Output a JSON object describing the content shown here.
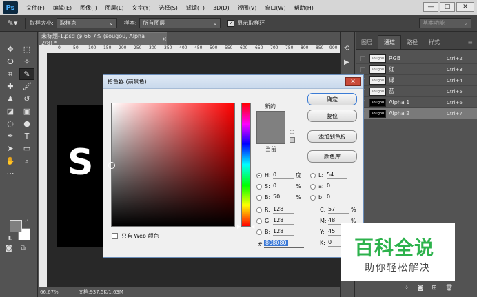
{
  "app": {
    "logo": "Ps"
  },
  "menu": [
    "文件(F)",
    "编辑(E)",
    "图像(I)",
    "图层(L)",
    "文字(Y)",
    "选择(S)",
    "滤镜(T)",
    "3D(D)",
    "视图(V)",
    "窗口(W)",
    "帮助(H)"
  ],
  "window_controls": {
    "minimize": "—",
    "maximize": "□",
    "close": "✕"
  },
  "options_bar": {
    "sample_size_label": "取样大小:",
    "sample_size_value": "取样点",
    "sample_label": "样本:",
    "sample_value": "所有图层",
    "show_ring_label": "显示取样环",
    "show_ring_checked": "✓",
    "workspace": "基本功能"
  },
  "document": {
    "tab_title": "未标题-1.psd @ 66.7% (sougou, Alpha 2/8) *",
    "tab_close": "×",
    "ruler_ticks": [
      "0",
      "50",
      "100",
      "150",
      "200",
      "250",
      "300",
      "350",
      "400",
      "450",
      "500",
      "550",
      "600",
      "650",
      "700",
      "750",
      "800",
      "850",
      "900"
    ],
    "canvas_text": "S",
    "zoom": "66.67%",
    "doc_info": "文档:937.5K/1.63M"
  },
  "dock_icons": [
    "history-icon",
    "play-icon"
  ],
  "panel": {
    "tabs": [
      "图层",
      "通道",
      "路径",
      "样式"
    ],
    "active_tab": "通道",
    "channels": [
      {
        "name": "RGB",
        "shortcut": "Ctrl+2",
        "thumb": "sougou",
        "dark": false
      },
      {
        "name": "红",
        "shortcut": "Ctrl+3",
        "thumb": "sougou",
        "dark": false
      },
      {
        "name": "绿",
        "shortcut": "Ctrl+4",
        "thumb": "sougou",
        "dark": false
      },
      {
        "name": "蓝",
        "shortcut": "Ctrl+5",
        "thumb": "sougou",
        "dark": false
      },
      {
        "name": "Alpha 1",
        "shortcut": "Ctrl+6",
        "thumb": "sougou",
        "dark": true
      },
      {
        "name": "Alpha 2",
        "shortcut": "Ctrl+7",
        "thumb": "sougou",
        "dark": true
      }
    ]
  },
  "color_picker": {
    "title": "拾色器 (前景色)",
    "new_label": "新的",
    "current_label": "当前",
    "web_only_label": "只有 Web 颜色",
    "buttons": {
      "ok": "确定",
      "reset": "复位",
      "add_swatch": "添加到色板",
      "libraries": "颜色库"
    },
    "current_color": "#808080",
    "fields_left": [
      {
        "label": "H:",
        "value": "0",
        "unit": "度"
      },
      {
        "label": "S:",
        "value": "0",
        "unit": "%"
      },
      {
        "label": "B:",
        "value": "50",
        "unit": "%"
      },
      {
        "label": "R:",
        "value": "128",
        "unit": ""
      },
      {
        "label": "G:",
        "value": "128",
        "unit": ""
      },
      {
        "label": "B:",
        "value": "128",
        "unit": ""
      }
    ],
    "fields_lab": [
      {
        "label": "L:",
        "value": "54"
      },
      {
        "label": "a:",
        "value": "0"
      },
      {
        "label": "b:",
        "value": "0"
      }
    ],
    "fields_cmyk": [
      {
        "label": "C:",
        "value": "57",
        "unit": "%"
      },
      {
        "label": "M:",
        "value": "48",
        "unit": "%"
      },
      {
        "label": "Y:",
        "value": "45",
        "unit": "%"
      },
      {
        "label": "K:",
        "value": "0",
        "unit": "%"
      }
    ],
    "hex_label": "#",
    "hex": "808080"
  },
  "watermark": {
    "title": "百科全说",
    "subtitle": "助你轻松解决"
  }
}
